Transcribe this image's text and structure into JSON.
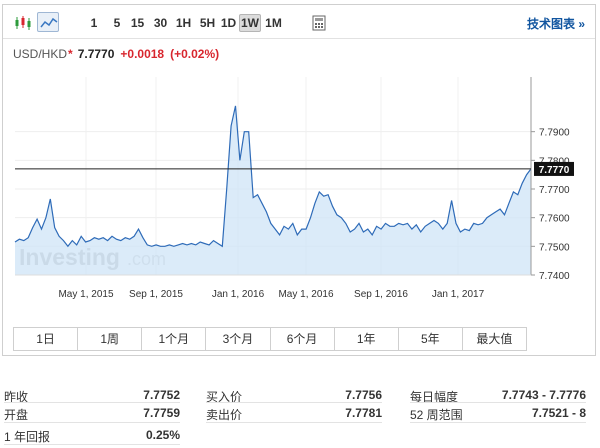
{
  "toolbar": {
    "icons": [
      "candlestick-icon",
      "area-chart-icon"
    ],
    "periods": [
      "1",
      "5",
      "15",
      "30",
      "1H",
      "5H",
      "1D",
      "1W",
      "1M"
    ],
    "active_period": "1W",
    "tech_chart_link": "技术图表 »"
  },
  "quote": {
    "symbol": "USD/HKD",
    "star": "*",
    "price": "7.7770",
    "change": "+0.0018",
    "change_pct": "(+0.02%)"
  },
  "chart_data": {
    "type": "area",
    "title": "",
    "xlabel": "",
    "ylabel": "",
    "x_tick_labels": [
      "May 1, 2015",
      "Sep 1, 2015",
      "Jan 1, 2016",
      "May 1, 2016",
      "Sep 1, 2016",
      "Jan 1, 2017"
    ],
    "y_tick_labels": [
      "7.7900",
      "7.7800",
      "7.7700",
      "7.7600",
      "7.7500",
      "7.7400"
    ],
    "ylim": [
      7.74,
      7.8
    ],
    "current_value_label": "7.7770",
    "current_value": 7.777,
    "watermark": "Investing.com",
    "series": [
      {
        "values": [
          7.7515,
          7.7525,
          7.752,
          7.753,
          7.7565,
          7.7595,
          7.756,
          7.76,
          7.7665,
          7.7565,
          7.7535,
          7.752,
          7.75,
          7.752,
          7.7505,
          7.7535,
          7.7515,
          7.752,
          7.753,
          7.7525,
          7.753,
          7.752,
          7.7535,
          7.7525,
          7.752,
          7.753,
          7.7525,
          7.7535,
          7.756,
          7.753,
          7.7505,
          7.75,
          7.7505,
          7.75,
          7.75,
          7.7505,
          7.75,
          7.7505,
          7.751,
          7.7505,
          7.751,
          7.7505,
          7.7515,
          7.751,
          7.7505,
          7.752,
          7.751,
          7.75,
          7.77,
          7.792,
          7.799,
          7.78,
          7.79,
          7.79,
          7.767,
          7.768,
          7.765,
          7.762,
          7.758,
          7.756,
          7.754,
          7.757,
          7.756,
          7.758,
          7.754,
          7.756,
          7.756,
          7.76,
          7.765,
          7.769,
          7.7675,
          7.768,
          7.764,
          7.761,
          7.76,
          7.758,
          7.755,
          7.756,
          7.758,
          7.755,
          7.756,
          7.754,
          7.757,
          7.756,
          7.758,
          7.757,
          7.757,
          7.758,
          7.7575,
          7.758,
          7.756,
          7.7575,
          7.755,
          7.757,
          7.758,
          7.759,
          7.758,
          7.756,
          7.758,
          7.766,
          7.758,
          7.755,
          7.756,
          7.7555,
          7.758,
          7.7575,
          7.758,
          7.76,
          7.761,
          7.762,
          7.763,
          7.761,
          7.765,
          7.769,
          7.768,
          7.772,
          7.775,
          7.777
        ]
      }
    ]
  },
  "ranges": [
    "1日",
    "1周",
    "1个月",
    "3个月",
    "6个月",
    "1年",
    "5年",
    "最大值"
  ],
  "stats": [
    {
      "label": "昨收",
      "value": "7.7752"
    },
    {
      "label": "开盘",
      "value": "7.7759"
    },
    {
      "label": "1 年回报",
      "value": "0.25%"
    },
    {
      "label": "买入价",
      "value": "7.7756"
    },
    {
      "label": "卖出价",
      "value": "7.7781"
    },
    {
      "label": "每日幅度",
      "value": "7.7743 - 7.7776"
    },
    {
      "label": "52 周范围",
      "value": "7.7521 - 8"
    }
  ]
}
